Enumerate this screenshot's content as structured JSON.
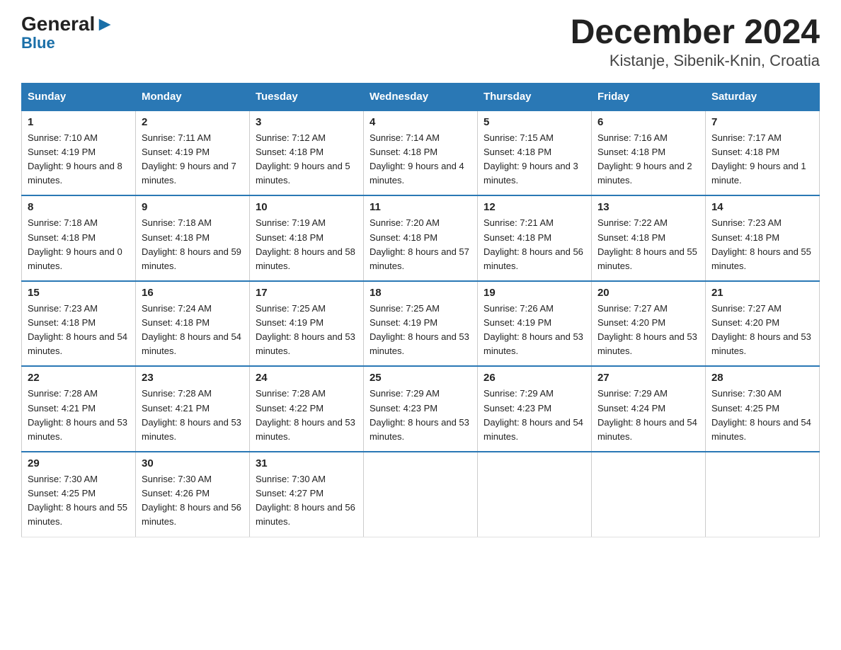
{
  "logo": {
    "line1": "General",
    "arrow": "▶",
    "line2": "Blue"
  },
  "title": "December 2024",
  "subtitle": "Kistanje, Sibenik-Knin, Croatia",
  "days_header": [
    "Sunday",
    "Monday",
    "Tuesday",
    "Wednesday",
    "Thursday",
    "Friday",
    "Saturday"
  ],
  "weeks": [
    [
      {
        "num": "1",
        "sunrise": "7:10 AM",
        "sunset": "4:19 PM",
        "daylight": "9 hours and 8 minutes."
      },
      {
        "num": "2",
        "sunrise": "7:11 AM",
        "sunset": "4:19 PM",
        "daylight": "9 hours and 7 minutes."
      },
      {
        "num": "3",
        "sunrise": "7:12 AM",
        "sunset": "4:18 PM",
        "daylight": "9 hours and 5 minutes."
      },
      {
        "num": "4",
        "sunrise": "7:14 AM",
        "sunset": "4:18 PM",
        "daylight": "9 hours and 4 minutes."
      },
      {
        "num": "5",
        "sunrise": "7:15 AM",
        "sunset": "4:18 PM",
        "daylight": "9 hours and 3 minutes."
      },
      {
        "num": "6",
        "sunrise": "7:16 AM",
        "sunset": "4:18 PM",
        "daylight": "9 hours and 2 minutes."
      },
      {
        "num": "7",
        "sunrise": "7:17 AM",
        "sunset": "4:18 PM",
        "daylight": "9 hours and 1 minute."
      }
    ],
    [
      {
        "num": "8",
        "sunrise": "7:18 AM",
        "sunset": "4:18 PM",
        "daylight": "9 hours and 0 minutes."
      },
      {
        "num": "9",
        "sunrise": "7:18 AM",
        "sunset": "4:18 PM",
        "daylight": "8 hours and 59 minutes."
      },
      {
        "num": "10",
        "sunrise": "7:19 AM",
        "sunset": "4:18 PM",
        "daylight": "8 hours and 58 minutes."
      },
      {
        "num": "11",
        "sunrise": "7:20 AM",
        "sunset": "4:18 PM",
        "daylight": "8 hours and 57 minutes."
      },
      {
        "num": "12",
        "sunrise": "7:21 AM",
        "sunset": "4:18 PM",
        "daylight": "8 hours and 56 minutes."
      },
      {
        "num": "13",
        "sunrise": "7:22 AM",
        "sunset": "4:18 PM",
        "daylight": "8 hours and 55 minutes."
      },
      {
        "num": "14",
        "sunrise": "7:23 AM",
        "sunset": "4:18 PM",
        "daylight": "8 hours and 55 minutes."
      }
    ],
    [
      {
        "num": "15",
        "sunrise": "7:23 AM",
        "sunset": "4:18 PM",
        "daylight": "8 hours and 54 minutes."
      },
      {
        "num": "16",
        "sunrise": "7:24 AM",
        "sunset": "4:18 PM",
        "daylight": "8 hours and 54 minutes."
      },
      {
        "num": "17",
        "sunrise": "7:25 AM",
        "sunset": "4:19 PM",
        "daylight": "8 hours and 53 minutes."
      },
      {
        "num": "18",
        "sunrise": "7:25 AM",
        "sunset": "4:19 PM",
        "daylight": "8 hours and 53 minutes."
      },
      {
        "num": "19",
        "sunrise": "7:26 AM",
        "sunset": "4:19 PM",
        "daylight": "8 hours and 53 minutes."
      },
      {
        "num": "20",
        "sunrise": "7:27 AM",
        "sunset": "4:20 PM",
        "daylight": "8 hours and 53 minutes."
      },
      {
        "num": "21",
        "sunrise": "7:27 AM",
        "sunset": "4:20 PM",
        "daylight": "8 hours and 53 minutes."
      }
    ],
    [
      {
        "num": "22",
        "sunrise": "7:28 AM",
        "sunset": "4:21 PM",
        "daylight": "8 hours and 53 minutes."
      },
      {
        "num": "23",
        "sunrise": "7:28 AM",
        "sunset": "4:21 PM",
        "daylight": "8 hours and 53 minutes."
      },
      {
        "num": "24",
        "sunrise": "7:28 AM",
        "sunset": "4:22 PM",
        "daylight": "8 hours and 53 minutes."
      },
      {
        "num": "25",
        "sunrise": "7:29 AM",
        "sunset": "4:23 PM",
        "daylight": "8 hours and 53 minutes."
      },
      {
        "num": "26",
        "sunrise": "7:29 AM",
        "sunset": "4:23 PM",
        "daylight": "8 hours and 54 minutes."
      },
      {
        "num": "27",
        "sunrise": "7:29 AM",
        "sunset": "4:24 PM",
        "daylight": "8 hours and 54 minutes."
      },
      {
        "num": "28",
        "sunrise": "7:30 AM",
        "sunset": "4:25 PM",
        "daylight": "8 hours and 54 minutes."
      }
    ],
    [
      {
        "num": "29",
        "sunrise": "7:30 AM",
        "sunset": "4:25 PM",
        "daylight": "8 hours and 55 minutes."
      },
      {
        "num": "30",
        "sunrise": "7:30 AM",
        "sunset": "4:26 PM",
        "daylight": "8 hours and 56 minutes."
      },
      {
        "num": "31",
        "sunrise": "7:30 AM",
        "sunset": "4:27 PM",
        "daylight": "8 hours and 56 minutes."
      },
      null,
      null,
      null,
      null
    ]
  ]
}
